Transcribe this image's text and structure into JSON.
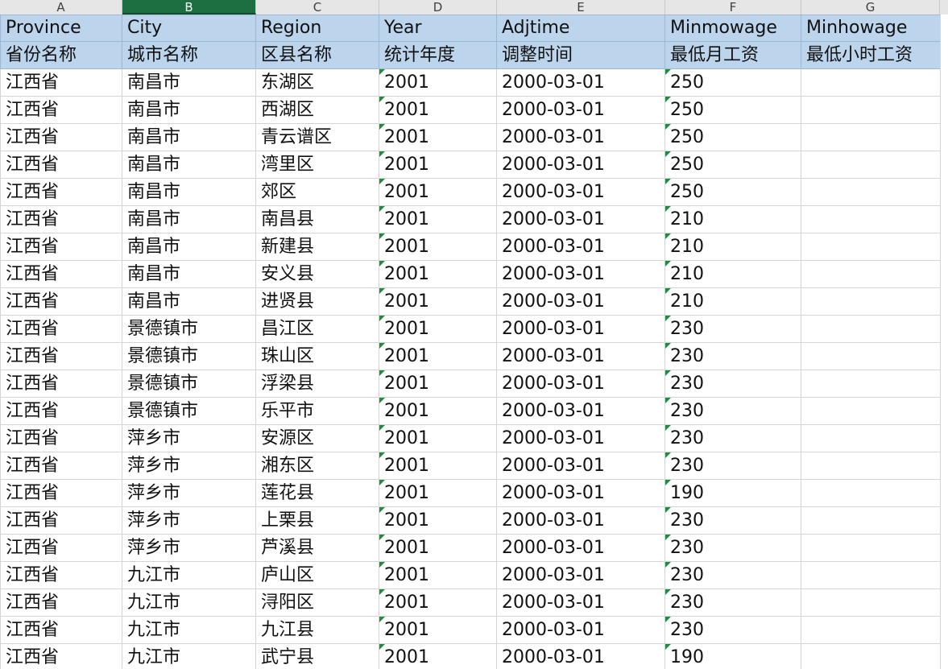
{
  "column_letters": [
    "A",
    "B",
    "C",
    "D",
    "E",
    "F",
    "G"
  ],
  "selected_column": "B",
  "header_en": [
    "Province",
    "City",
    "Region",
    "Year",
    "Adjtime",
    "Minmowage",
    "Minhowage"
  ],
  "header_cn": [
    "省份名称",
    "城市名称",
    "区县名称",
    "统计年度",
    "调整时间",
    "最低月工资",
    "最低小时工资"
  ],
  "rows": [
    [
      "江西省",
      "南昌市",
      "东湖区",
      "2001",
      "2000-03-01",
      "250",
      ""
    ],
    [
      "江西省",
      "南昌市",
      "西湖区",
      "2001",
      "2000-03-01",
      "250",
      ""
    ],
    [
      "江西省",
      "南昌市",
      "青云谱区",
      "2001",
      "2000-03-01",
      "250",
      ""
    ],
    [
      "江西省",
      "南昌市",
      "湾里区",
      "2001",
      "2000-03-01",
      "250",
      ""
    ],
    [
      "江西省",
      "南昌市",
      "郊区",
      "2001",
      "2000-03-01",
      "250",
      ""
    ],
    [
      "江西省",
      "南昌市",
      "南昌县",
      "2001",
      "2000-03-01",
      "210",
      ""
    ],
    [
      "江西省",
      "南昌市",
      "新建县",
      "2001",
      "2000-03-01",
      "210",
      ""
    ],
    [
      "江西省",
      "南昌市",
      "安义县",
      "2001",
      "2000-03-01",
      "210",
      ""
    ],
    [
      "江西省",
      "南昌市",
      "进贤县",
      "2001",
      "2000-03-01",
      "210",
      ""
    ],
    [
      "江西省",
      "景德镇市",
      "昌江区",
      "2001",
      "2000-03-01",
      "230",
      ""
    ],
    [
      "江西省",
      "景德镇市",
      "珠山区",
      "2001",
      "2000-03-01",
      "230",
      ""
    ],
    [
      "江西省",
      "景德镇市",
      "浮梁县",
      "2001",
      "2000-03-01",
      "230",
      ""
    ],
    [
      "江西省",
      "景德镇市",
      "乐平市",
      "2001",
      "2000-03-01",
      "230",
      ""
    ],
    [
      "江西省",
      "萍乡市",
      "安源区",
      "2001",
      "2000-03-01",
      "230",
      ""
    ],
    [
      "江西省",
      "萍乡市",
      "湘东区",
      "2001",
      "2000-03-01",
      "230",
      ""
    ],
    [
      "江西省",
      "萍乡市",
      "莲花县",
      "2001",
      "2000-03-01",
      "190",
      ""
    ],
    [
      "江西省",
      "萍乡市",
      "上栗县",
      "2001",
      "2000-03-01",
      "230",
      ""
    ],
    [
      "江西省",
      "萍乡市",
      "芦溪县",
      "2001",
      "2000-03-01",
      "230",
      ""
    ],
    [
      "江西省",
      "九江市",
      "庐山区",
      "2001",
      "2000-03-01",
      "230",
      ""
    ],
    [
      "江西省",
      "九江市",
      "浔阳区",
      "2001",
      "2000-03-01",
      "230",
      ""
    ],
    [
      "江西省",
      "九江市",
      "九江县",
      "2001",
      "2000-03-01",
      "230",
      ""
    ],
    [
      "江西省",
      "九江市",
      "武宁县",
      "2001",
      "2000-03-01",
      "190",
      ""
    ]
  ],
  "text_stored_number_columns": [
    3,
    5
  ],
  "colors": {
    "header_fill": "#bcd4ec",
    "selected_column_fill": "#1d6f42",
    "error_indicator": "#1e8e3e"
  }
}
